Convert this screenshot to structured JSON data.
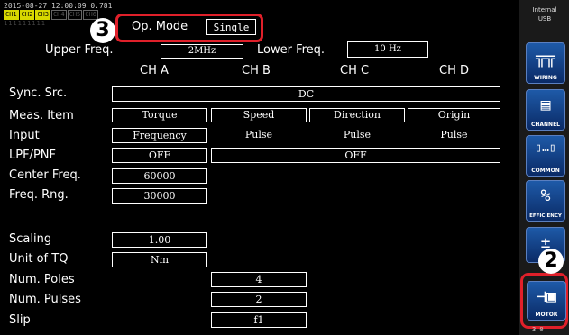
{
  "status": {
    "timestamp": "2015-08-27 12:00:09 0.781",
    "channel_chips": [
      "CH1",
      "CH2",
      "CH3",
      "CH4",
      "CH5",
      "CH6"
    ],
    "chip_codes": "111111111"
  },
  "op_mode": {
    "label": "Op. Mode",
    "value": "Single",
    "callout": "3"
  },
  "freq": {
    "upper_label": "Upper Freq.",
    "upper_value": "2MHz",
    "lower_label": "Lower Freq.",
    "lower_value": "10 Hz"
  },
  "channels": [
    "CH A",
    "CH B",
    "CH C",
    "CH D"
  ],
  "rows": {
    "sync_src": {
      "label": "Sync. Src.",
      "value": "DC"
    },
    "meas_item": {
      "label": "Meas. Item",
      "values": [
        "Torque",
        "Speed",
        "Direction",
        "Origin"
      ]
    },
    "input": {
      "label": "Input",
      "values": [
        "Frequency",
        "Pulse",
        "Pulse",
        "Pulse"
      ]
    },
    "lpf_pnf": {
      "label": "LPF/PNF",
      "cha": "OFF",
      "rest": "OFF"
    },
    "center_freq": {
      "label": "Center Freq.",
      "value": "60000"
    },
    "freq_rng": {
      "label": "Freq. Rng.",
      "value": "30000"
    },
    "scaling": {
      "label": "Scaling",
      "value": "1.00"
    },
    "unit_tq": {
      "label": "Unit of TQ",
      "value": "Nm"
    },
    "num_poles": {
      "label": "Num. Poles",
      "value": "4"
    },
    "num_pulses": {
      "label": "Num. Pulses",
      "value": "2"
    },
    "slip": {
      "label": "Slip",
      "value": "f1"
    }
  },
  "sidebar": {
    "storage": {
      "line1": "Internal",
      "line2": "USB"
    },
    "buttons": [
      {
        "label": "WIRING",
        "icon": "wiring-icon",
        "glyph": "╦╦"
      },
      {
        "label": "CHANNEL",
        "icon": "channel-icon",
        "glyph": "▤"
      },
      {
        "label": "COMMON",
        "icon": "common-icon",
        "glyph": "▯…▯"
      },
      {
        "label": "EFFICIENCY",
        "icon": "efficiency-icon",
        "glyph": "%"
      },
      {
        "label": "",
        "icon": "scaling-icon",
        "glyph": "±"
      },
      {
        "label": "MOTOR",
        "icon": "motor-icon",
        "glyph": "⊣▣"
      }
    ],
    "motor_callout": "2",
    "footer": "3  0"
  },
  "colors": {
    "accent_red": "#e0202a",
    "button_blue": "#1e5aa8",
    "chip_yellow": "#d8d800"
  }
}
